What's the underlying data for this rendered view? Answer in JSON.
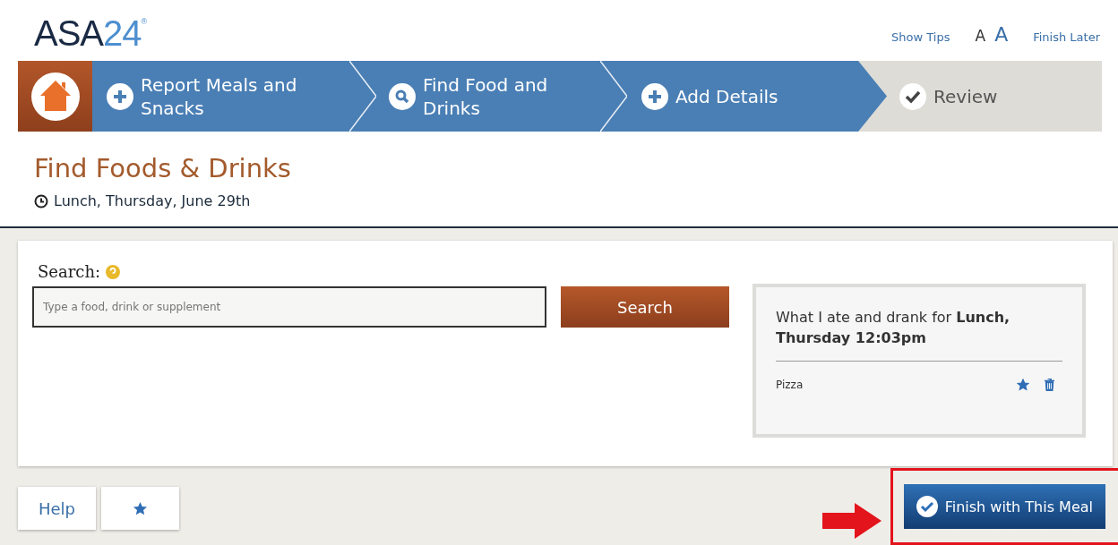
{
  "logo": {
    "name": "ASA",
    "number": "24",
    "mark": "®"
  },
  "header_links": [
    {
      "kind": "link",
      "label": "Show Tips"
    },
    {
      "kind": "font-small",
      "label": "A"
    },
    {
      "kind": "font-large",
      "label": "A"
    },
    {
      "kind": "link",
      "label": "Finish Later"
    }
  ],
  "steps": [
    {
      "kind": "add",
      "label": "Report Meals and Snacks",
      "completed": true
    },
    {
      "kind": "search",
      "label": "Find Food and Drinks",
      "completed": true
    },
    {
      "kind": "add",
      "label": "Add Details",
      "completed": true
    },
    {
      "kind": "review",
      "label": "Review",
      "completed": false
    }
  ],
  "page_title": "Find Foods & Drinks",
  "meal_date": "Lunch, Thursday, June 29th",
  "search": {
    "label": "Search:",
    "placeholder": "Type a food, drink or supplement",
    "button": "Search"
  },
  "meal_summary": {
    "title": "What I ate and drank for **Lunch, Thursday 12:03pm**",
    "items": [
      {
        "name": "Pizza",
        "favorite": true
      }
    ]
  },
  "footer_buttons": [
    {
      "kind": "text",
      "label": "Help"
    },
    {
      "kind": "star"
    }
  ],
  "finish_button": "Finish with This Meal"
}
